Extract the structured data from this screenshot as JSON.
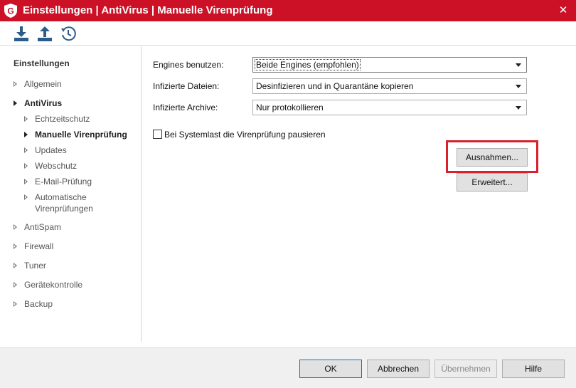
{
  "window": {
    "title": "Einstellungen | AntiVirus | Manuelle Virenprüfung",
    "close_label": "✕",
    "logo_letter": "G"
  },
  "toolbar": {
    "buttons": [
      {
        "icon": "import-icon"
      },
      {
        "icon": "export-icon"
      },
      {
        "icon": "reset-icon"
      }
    ]
  },
  "sidebar": {
    "heading": "Einstellungen",
    "items": [
      {
        "label": "Allgemein"
      },
      {
        "label": "AntiVirus"
      },
      {
        "label": "Echtzeitschutz"
      },
      {
        "label": "Manuelle Virenprüfung"
      },
      {
        "label": "Updates"
      },
      {
        "label": "Webschutz"
      },
      {
        "label": "E-Mail-Prüfung"
      },
      {
        "label": "Automatische Virenprüfungen"
      },
      {
        "label": "AntiSpam"
      },
      {
        "label": "Firewall"
      },
      {
        "label": "Tuner"
      },
      {
        "label": "Gerätekontrolle"
      },
      {
        "label": "Backup"
      }
    ]
  },
  "main": {
    "engines_label": "Engines benutzen:",
    "engines_value": "Beide Engines (empfohlen)",
    "infected_files_label": "Infizierte Dateien:",
    "infected_files_value": "Desinfizieren und in Quarantäne kopieren",
    "infected_archives_label": "Infizierte Archive:",
    "infected_archives_value": "Nur protokollieren",
    "pause_checkbox_label": "Bei Systemlast die Virenprüfung pausieren",
    "pause_checked": false,
    "exceptions_button": "Ausnahmen...",
    "advanced_button": "Erweitert..."
  },
  "footer": {
    "ok": "OK",
    "cancel": "Abbrechen",
    "apply": "Übernehmen",
    "help": "Hilfe"
  },
  "colors": {
    "titlebar": "#cc1126",
    "highlight": "#d9202c",
    "default_button_border": "#0078d7",
    "toolbar_icon": "#2c5d8a"
  }
}
